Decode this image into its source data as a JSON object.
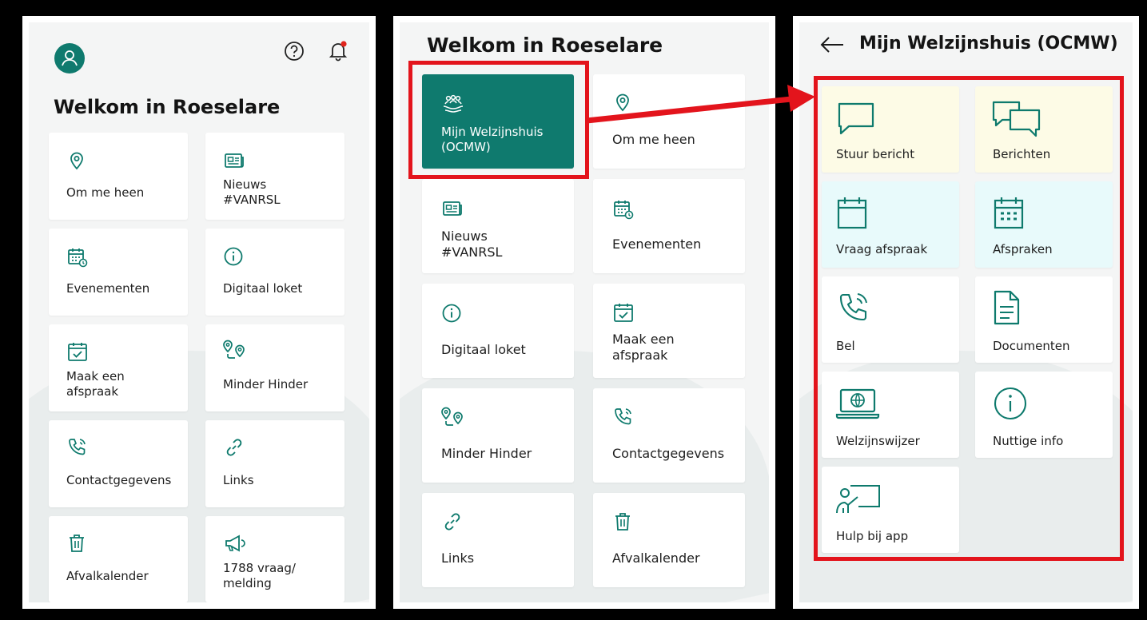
{
  "colors": {
    "accent": "#0f7a6e",
    "icon": "#0e7a6d",
    "highlight": "#e3141c",
    "badge": "#e0241c"
  },
  "screen1": {
    "title": "Welkom in Roeselare",
    "header_icons": [
      "avatar-icon",
      "help-icon",
      "bell-icon"
    ],
    "tiles": [
      {
        "label": "Om me heen",
        "icon": "location-pin-icon"
      },
      {
        "label": "Nieuws\n#VANRSL",
        "icon": "newspaper-icon"
      },
      {
        "label": "Evenementen",
        "icon": "calendar-clock-icon"
      },
      {
        "label": "Digitaal loket",
        "icon": "info-icon"
      },
      {
        "label": "Maak een\nafspraak",
        "icon": "calendar-check-icon"
      },
      {
        "label": "Minder Hinder",
        "icon": "route-pins-icon"
      },
      {
        "label": "Contactgegevens",
        "icon": "phone-icon"
      },
      {
        "label": "Links",
        "icon": "link-icon"
      },
      {
        "label": "Afvalkalender",
        "icon": "trash-icon"
      },
      {
        "label": "1788 vraag/\nmelding",
        "icon": "megaphone-icon"
      }
    ]
  },
  "screen2": {
    "title": "Welkom in Roeselare",
    "tiles": [
      {
        "label": "Mijn Welzijnshuis\n(OCMW)",
        "icon": "people-hands-icon"
      },
      {
        "label": "Om me heen",
        "icon": "location-pin-icon"
      },
      {
        "label": "Nieuws\n#VANRSL",
        "icon": "newspaper-icon"
      },
      {
        "label": "Evenementen",
        "icon": "calendar-clock-icon"
      },
      {
        "label": "Digitaal loket",
        "icon": "info-icon"
      },
      {
        "label": "Maak een\nafspraak",
        "icon": "calendar-check-icon"
      },
      {
        "label": "Minder Hinder",
        "icon": "route-pins-icon"
      },
      {
        "label": "Contactgegevens",
        "icon": "phone-icon"
      },
      {
        "label": "Links",
        "icon": "link-icon"
      },
      {
        "label": "Afvalkalender",
        "icon": "trash-icon"
      }
    ]
  },
  "screen3": {
    "title": "Mijn Welzijnshuis (OCMW)",
    "back_icon": "arrow-left-icon",
    "tiles": [
      {
        "label": "Stuur bericht",
        "icon": "chat-bubble-icon"
      },
      {
        "label": "Berichten",
        "icon": "chat-bubbles-icon"
      },
      {
        "label": "Vraag afspraak",
        "icon": "calendar-icon"
      },
      {
        "label": "Afspraken",
        "icon": "calendar-grid-icon"
      },
      {
        "label": "Bel",
        "icon": "phone-call-icon"
      },
      {
        "label": "Documenten",
        "icon": "document-icon"
      },
      {
        "label": "Welzijnswijzer",
        "icon": "laptop-globe-icon"
      },
      {
        "label": "Nuttige info",
        "icon": "info-icon"
      },
      {
        "label": "Hulp bij app",
        "icon": "presenter-icon"
      }
    ]
  }
}
